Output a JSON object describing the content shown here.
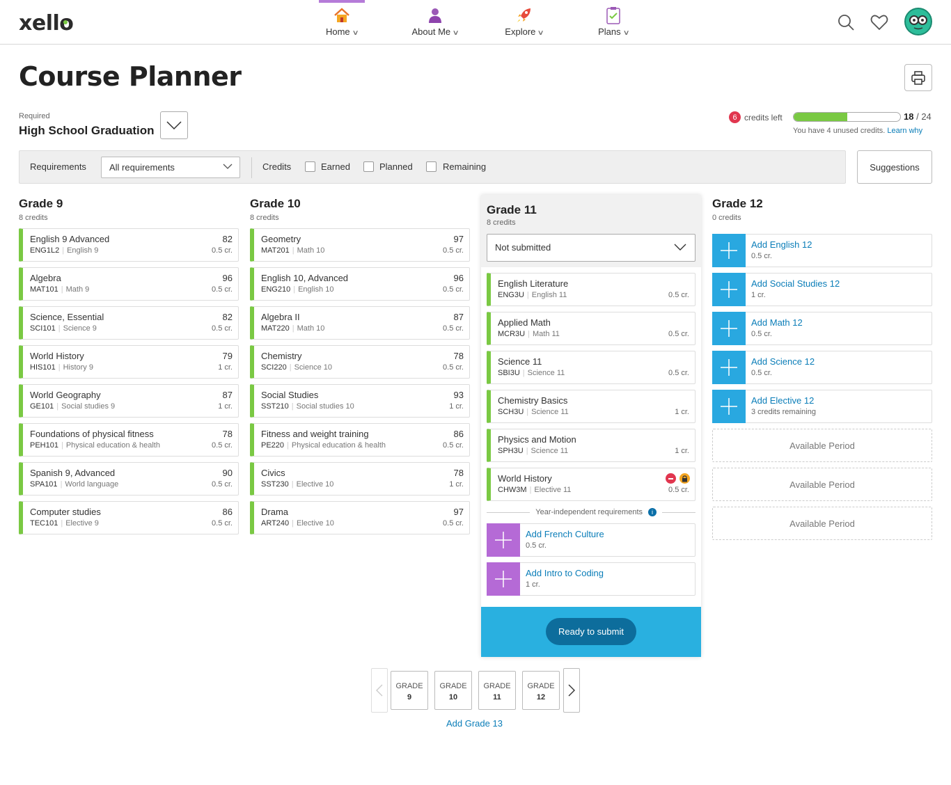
{
  "app": {
    "logo": "xello"
  },
  "nav": [
    {
      "label": "Home",
      "icon": "house-icon",
      "active": true
    },
    {
      "label": "About Me",
      "icon": "person-icon",
      "active": false
    },
    {
      "label": "Explore",
      "icon": "rocket-icon",
      "active": false
    },
    {
      "label": "Plans",
      "icon": "clipboard-icon",
      "active": false
    }
  ],
  "page": {
    "title": "Course Planner"
  },
  "requirement": {
    "label": "Required",
    "value": "High School Graduation"
  },
  "credits": {
    "left_count": "6",
    "left_label": "credits left",
    "earned": "18",
    "total": "/ 24",
    "progress_fraction": 0.5,
    "unused_text": "You have 4 unused credits.",
    "learn_why": "Learn why"
  },
  "filters": {
    "requirements_label": "Requirements",
    "requirements_value": "All requirements",
    "credits_label": "Credits",
    "earned": "Earned",
    "planned": "Planned",
    "remaining": "Remaining",
    "suggestions": "Suggestions"
  },
  "grade9": {
    "title": "Grade 9",
    "credits": "8 credits",
    "courses": [
      {
        "name": "English 9 Advanced",
        "code": "ENG1L2",
        "cat": "English 9",
        "grade": "82",
        "cr": "0.5 cr."
      },
      {
        "name": "Algebra",
        "code": "MAT101",
        "cat": "Math 9",
        "grade": "96",
        "cr": "0.5 cr."
      },
      {
        "name": "Science, Essential",
        "code": "SCI101",
        "cat": "Science 9",
        "grade": "82",
        "cr": "0.5 cr."
      },
      {
        "name": "World History",
        "code": "HIS101",
        "cat": "History 9",
        "grade": "79",
        "cr": "1 cr."
      },
      {
        "name": "World Geography",
        "code": "GE101",
        "cat": "Social studies 9",
        "grade": "87",
        "cr": "1 cr."
      },
      {
        "name": "Foundations of physical fitness",
        "code": "PEH101",
        "cat": "Physical education & health",
        "grade": "78",
        "cr": "0.5 cr."
      },
      {
        "name": "Spanish 9, Advanced",
        "code": "SPA101",
        "cat": "World language",
        "grade": "90",
        "cr": "0.5 cr."
      },
      {
        "name": "Computer studies",
        "code": "TEC101",
        "cat": "Elective 9",
        "grade": "86",
        "cr": "0.5 cr."
      }
    ]
  },
  "grade10": {
    "title": "Grade 10",
    "credits": "8 credits",
    "courses": [
      {
        "name": "Geometry",
        "code": "MAT201",
        "cat": "Math 10",
        "grade": "97",
        "cr": "0.5 cr."
      },
      {
        "name": "English 10, Advanced",
        "code": "ENG210",
        "cat": "English 10",
        "grade": "96",
        "cr": "0.5 cr."
      },
      {
        "name": "Algebra II",
        "code": "MAT220",
        "cat": "Math 10",
        "grade": "87",
        "cr": "0.5 cr."
      },
      {
        "name": "Chemistry",
        "code": "SCI220",
        "cat": "Science 10",
        "grade": "78",
        "cr": "0.5 cr."
      },
      {
        "name": "Social Studies",
        "code": "SST210",
        "cat": "Social studies 10",
        "grade": "93",
        "cr": "1 cr."
      },
      {
        "name": "Fitness and weight training",
        "code": "PE220",
        "cat": "Physical education & health",
        "grade": "86",
        "cr": "0.5 cr."
      },
      {
        "name": "Civics",
        "code": "SST230",
        "cat": "Elective 10",
        "grade": "78",
        "cr": "1 cr."
      },
      {
        "name": "Drama",
        "code": "ART240",
        "cat": "Elective 10",
        "grade": "97",
        "cr": "0.5 cr."
      }
    ]
  },
  "grade11": {
    "title": "Grade 11",
    "credits": "8 credits",
    "status": "Not submitted",
    "courses": [
      {
        "name": "English Literature",
        "code": "ENG3U",
        "cat": "English 11",
        "grade": "",
        "cr": "0.5 cr."
      },
      {
        "name": "Applied Math",
        "code": "MCR3U",
        "cat": "Math 11",
        "grade": "",
        "cr": "0.5 cr."
      },
      {
        "name": "Science 11",
        "code": "SBI3U",
        "cat": "Science 11",
        "grade": "",
        "cr": "0.5 cr."
      },
      {
        "name": "Chemistry Basics",
        "code": "SCH3U",
        "cat": "Science 11",
        "grade": "",
        "cr": "1 cr."
      },
      {
        "name": "Physics and Motion",
        "code": "SPH3U",
        "cat": "Science 11",
        "grade": "",
        "cr": "1 cr."
      },
      {
        "name": "World History",
        "code": "CHW3M",
        "cat": "Elective 11",
        "grade": "",
        "cr": "0.5 cr."
      }
    ],
    "year_independent": "Year-independent requirements",
    "info": "i",
    "adds": [
      {
        "name": "Add French Culture",
        "cr": "0.5 cr."
      },
      {
        "name": "Add Intro to Coding",
        "cr": "1 cr."
      }
    ],
    "submit": "Ready to submit"
  },
  "grade12": {
    "title": "Grade 12",
    "credits": "0 credits",
    "adds": [
      {
        "name": "Add English 12",
        "cr": "0.5 cr."
      },
      {
        "name": "Add Social Studies 12",
        "cr": "1 cr."
      },
      {
        "name": "Add Math 12",
        "cr": "0.5 cr."
      },
      {
        "name": "Add Science 12",
        "cr": "0.5 cr."
      },
      {
        "name": "Add Elective 12",
        "cr": "3 credits remaining"
      }
    ],
    "available": [
      "Available Period",
      "Available Period",
      "Available Period"
    ]
  },
  "pager": [
    {
      "label": "GRADE",
      "num": "9"
    },
    {
      "label": "GRADE",
      "num": "10"
    },
    {
      "label": "GRADE",
      "num": "11"
    },
    {
      "label": "GRADE",
      "num": "12"
    }
  ],
  "add_grade": "Add Grade 13",
  "colors": {
    "accent_green": "#7ac943",
    "link_blue": "#0a7db8",
    "add_blue": "#29a8e0",
    "add_purple": "#b56ad6",
    "submit_blue": "#29b0e0"
  }
}
